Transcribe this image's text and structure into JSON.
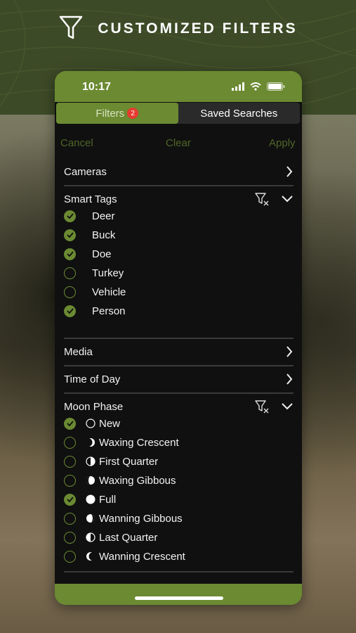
{
  "header": {
    "title": "CUSTOMIZED FILTERS",
    "icon": "filter-icon"
  },
  "status_bar": {
    "time": "10:17"
  },
  "segmented": {
    "tabs": [
      {
        "label": "Filters",
        "badge": "2",
        "active": true
      },
      {
        "label": "Saved Searches",
        "active": false
      }
    ]
  },
  "actions": {
    "cancel": "Cancel",
    "clear": "Clear",
    "apply": "Apply"
  },
  "sections": {
    "cameras": "Cameras",
    "smart_tags": {
      "title": "Smart Tags",
      "items": [
        {
          "label": "Deer",
          "checked": true
        },
        {
          "label": "Buck",
          "checked": true
        },
        {
          "label": "Doe",
          "checked": true
        },
        {
          "label": "Turkey",
          "checked": false
        },
        {
          "label": "Vehicle",
          "checked": false
        },
        {
          "label": "Person",
          "checked": true
        }
      ]
    },
    "media": "Media",
    "time_of_day": "Time of Day",
    "moon_phase": {
      "title": "Moon Phase",
      "items": [
        {
          "label": "New",
          "checked": true,
          "icon": "new-moon-icon"
        },
        {
          "label": "Waxing Crescent",
          "checked": false,
          "icon": "waxing-crescent-icon"
        },
        {
          "label": "First Quarter",
          "checked": false,
          "icon": "first-quarter-icon"
        },
        {
          "label": "Waxing Gibbous",
          "checked": false,
          "icon": "waxing-gibbous-icon"
        },
        {
          "label": "Full",
          "checked": true,
          "icon": "full-moon-icon"
        },
        {
          "label": "Wanning Gibbous",
          "checked": false,
          "icon": "waning-gibbous-icon"
        },
        {
          "label": "Last Quarter",
          "checked": false,
          "icon": "last-quarter-icon"
        },
        {
          "label": "Wanning Crescent",
          "checked": false,
          "icon": "waning-crescent-icon"
        }
      ]
    }
  },
  "colors": {
    "accent": "#6b8a32",
    "background": "#101010",
    "badge": "#e63b30"
  }
}
